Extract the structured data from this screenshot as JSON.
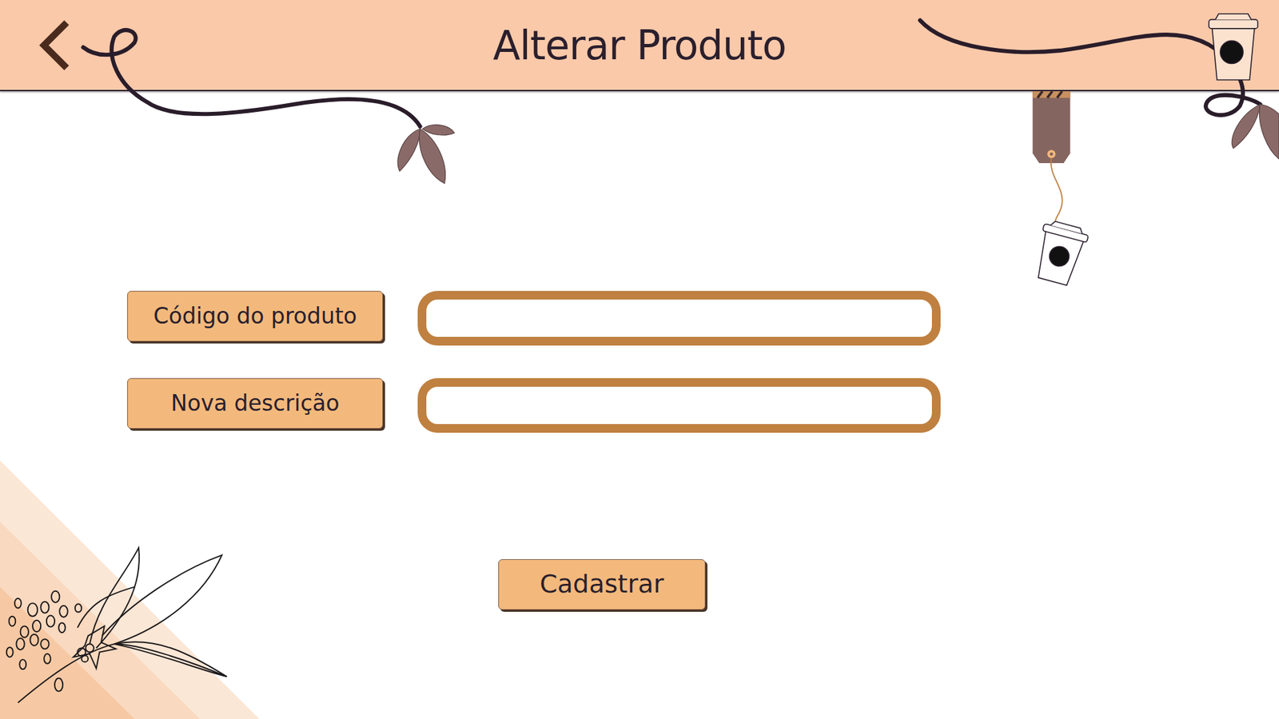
{
  "header": {
    "title": "Alterar Produto"
  },
  "fields": [
    {
      "label": "Código do produto"
    },
    {
      "label": "Nova descrição"
    }
  ],
  "buttons": [
    "Cadastrar"
  ]
}
